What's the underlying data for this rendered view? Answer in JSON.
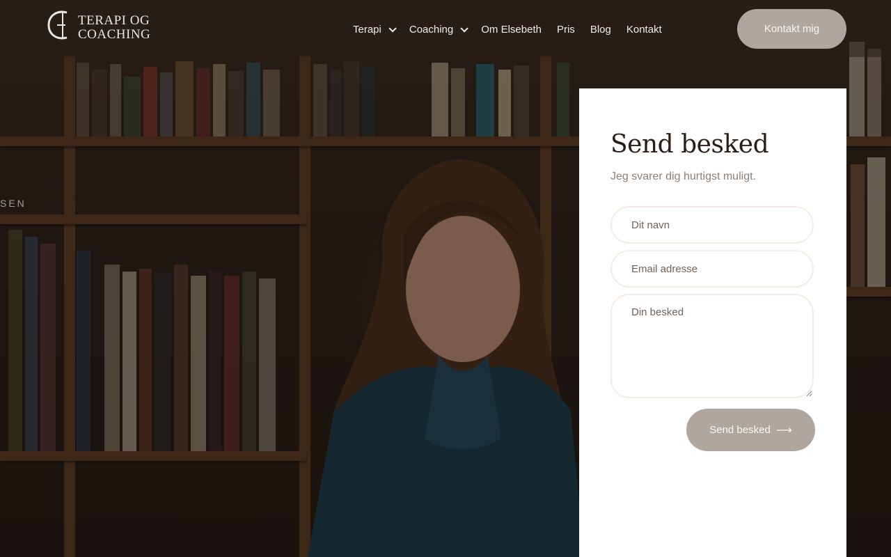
{
  "brand": {
    "logo_text_line1": "TERAPI OG",
    "logo_text_line2": "COACHING"
  },
  "nav": {
    "items": [
      {
        "label": "Terapi",
        "has_dropdown": true
      },
      {
        "label": "Coaching",
        "has_dropdown": true
      },
      {
        "label": "Om Elsebeth",
        "has_dropdown": false
      },
      {
        "label": "Pris",
        "has_dropdown": false
      },
      {
        "label": "Blog",
        "has_dropdown": false
      },
      {
        "label": "Kontakt",
        "has_dropdown": false
      }
    ],
    "cta_label": "Kontakt mig"
  },
  "hero": {
    "side_text": "SEN"
  },
  "contact": {
    "title": "Send besked",
    "subtitle": "Jeg svarer dig hurtigst muligt.",
    "name_placeholder": "Dit navn",
    "email_placeholder": "Email adresse",
    "message_placeholder": "Din besked",
    "submit_label": "Send besked",
    "submit_icon": "arrow-right-icon"
  },
  "colors": {
    "accent_button": "#b0a69d",
    "card_bg": "#ffffff",
    "title_text": "#2a1e17",
    "field_border": "#f6ece3"
  }
}
